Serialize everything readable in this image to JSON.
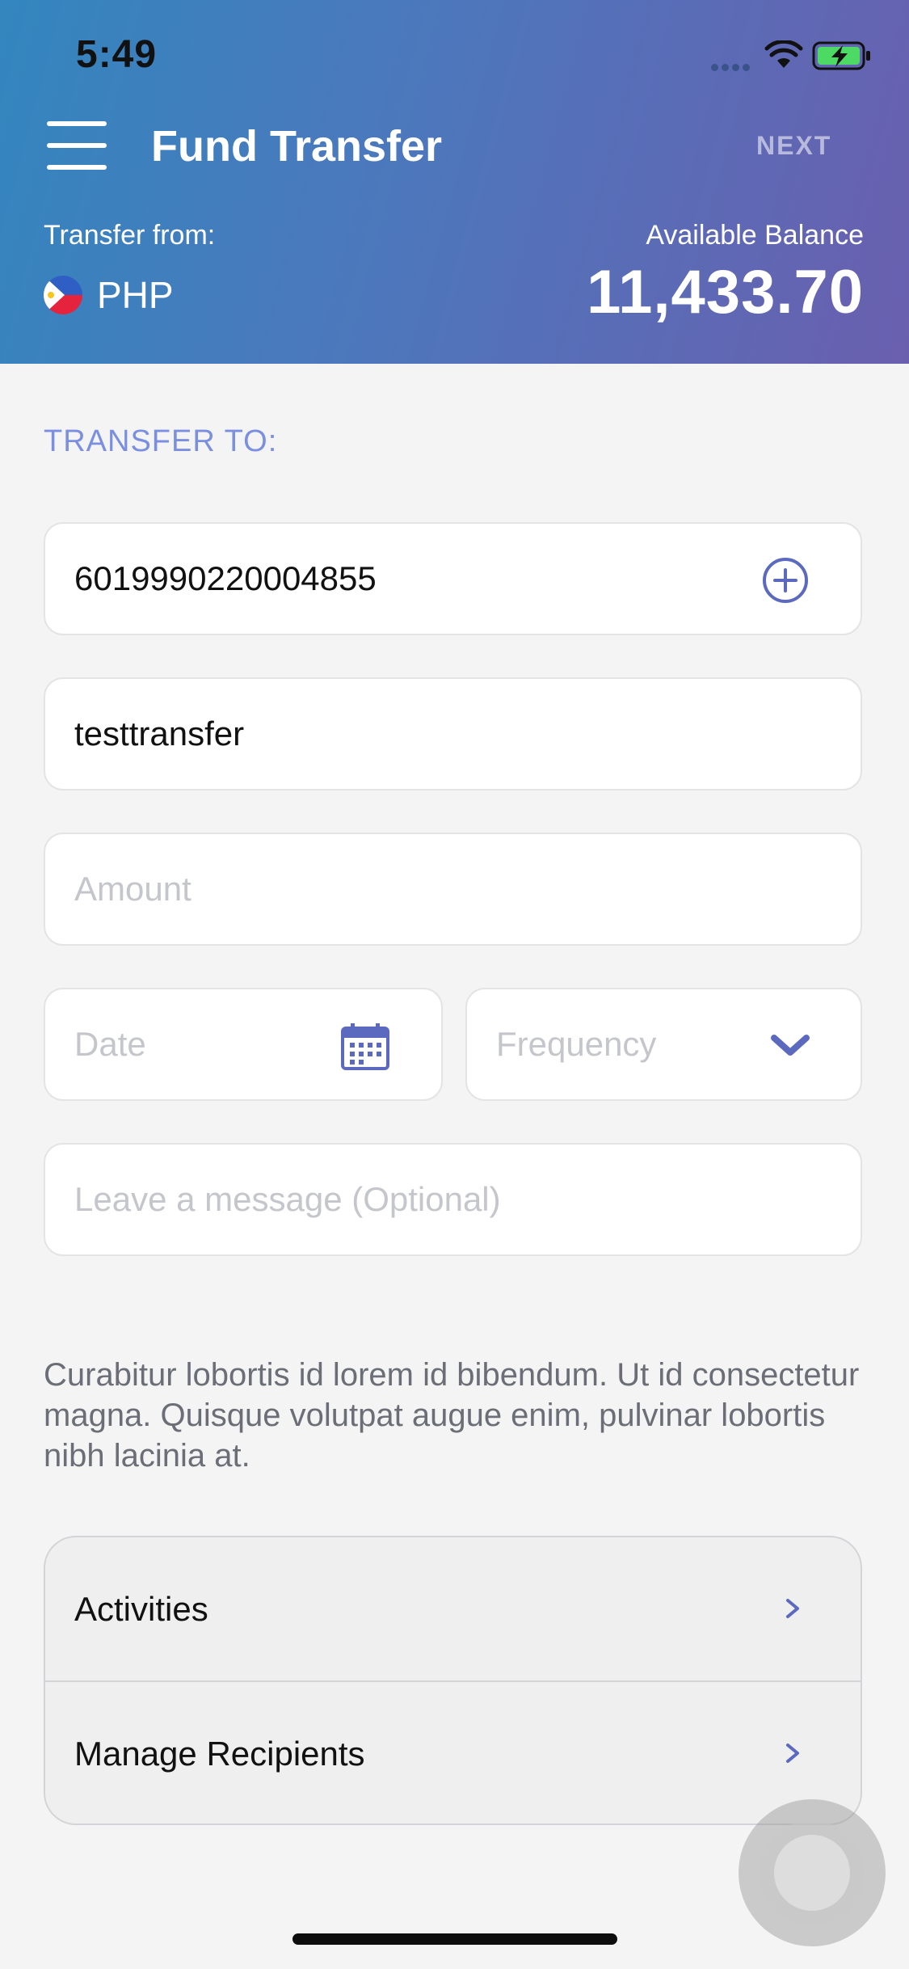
{
  "status_bar": {
    "time": "5:49",
    "icons": [
      "cellular-signal-icon",
      "wifi-icon",
      "battery-charging-icon"
    ]
  },
  "header": {
    "menu_icon": "hamburger-menu-icon",
    "title": "Fund Transfer",
    "next_label": "NEXT",
    "transfer_from_label": "Transfer from:",
    "currency": "PHP",
    "flag_icon": "philippines-flag-icon",
    "balance_label": "Available Balance",
    "balance_value": "11,433.70"
  },
  "form": {
    "section_label": "TRANSFER TO:",
    "account_number": "6019990220004855",
    "add_icon": "plus-circle-icon",
    "recipient_name": "testtransfer",
    "amount_placeholder": "Amount",
    "date_placeholder": "Date",
    "date_icon": "calendar-icon",
    "frequency_placeholder": "Frequency",
    "frequency_icon": "chevron-down-icon",
    "message_placeholder": "Leave a message (Optional)"
  },
  "description": "Curabitur lobortis id lorem id bibendum. Ut id consectetur magna. Quisque volutpat augue enim, pulvinar lobortis nibh lacinia at.",
  "links": [
    {
      "label": "Activities",
      "icon": "chevron-right-icon"
    },
    {
      "label": "Manage Recipients",
      "icon": "chevron-right-icon"
    }
  ],
  "colors": {
    "accent": "#5b6abf",
    "section_label": "#7b8fe0",
    "header_gradient_start": "#3386bf",
    "header_gradient_end": "#6a5faf"
  }
}
